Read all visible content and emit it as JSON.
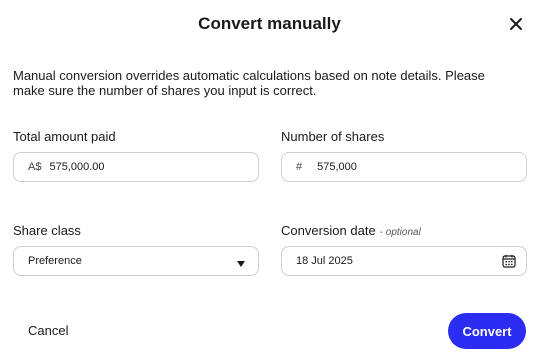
{
  "dialog": {
    "title": "Convert manually",
    "description": "Manual conversion overrides automatic calculations based on note details. Please make sure the number of shares you input is correct."
  },
  "fields": {
    "total_amount_paid": {
      "label": "Total amount paid",
      "prefix": "A$",
      "value": "575,000.00"
    },
    "number_of_shares": {
      "label": "Number of shares",
      "prefix": "#",
      "value": "575,000"
    },
    "share_class": {
      "label": "Share class",
      "selected": "Preference"
    },
    "conversion_date": {
      "label": "Conversion date",
      "optional_tag": "- optional",
      "value": "18 Jul 2025"
    }
  },
  "actions": {
    "cancel_label": "Cancel",
    "convert_label": "Convert"
  },
  "icons": {
    "close": "close-icon",
    "dropdown": "caret-down-icon",
    "calendar": "calendar-icon"
  },
  "colors": {
    "primary": "#2b2ef2",
    "border": "#cfcfcf"
  }
}
